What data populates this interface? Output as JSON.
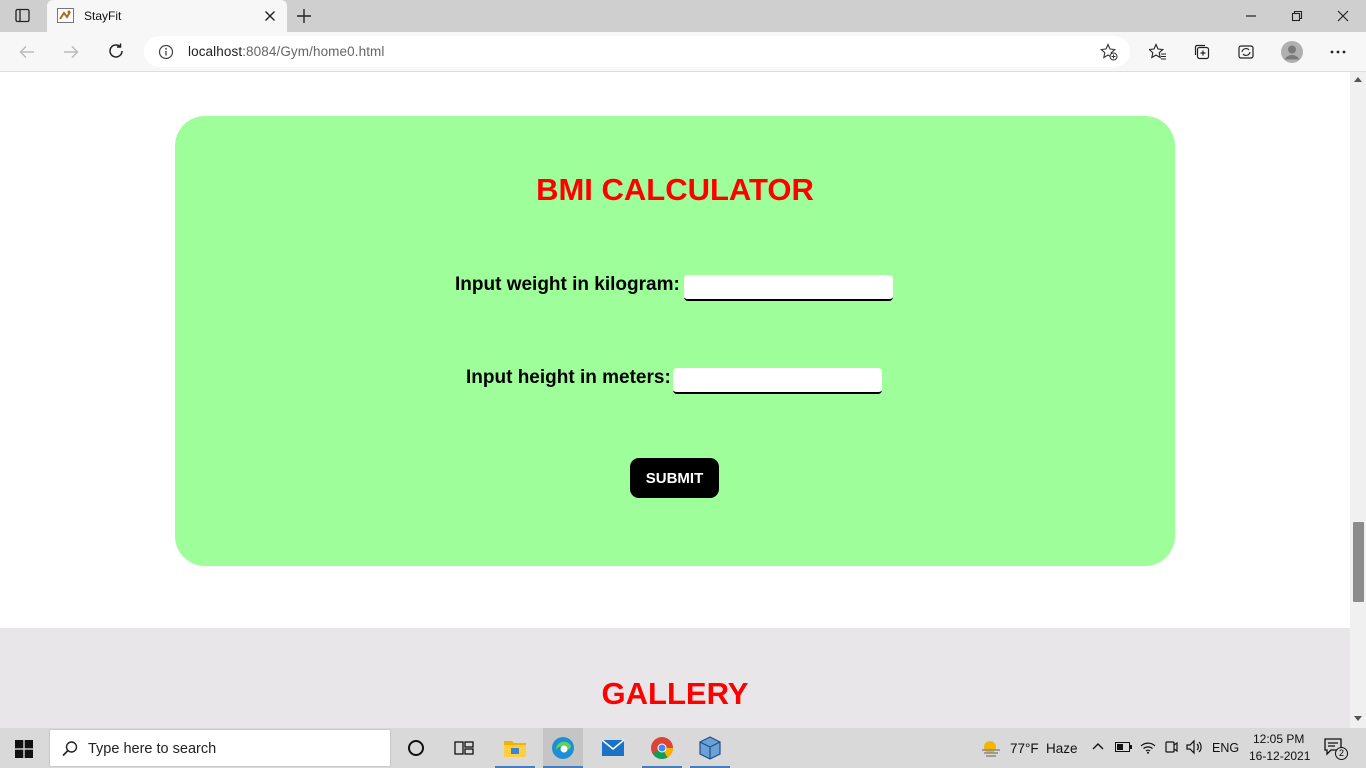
{
  "browser": {
    "tab_title": "StayFit",
    "url_host": "localhost",
    "url_rest": ":8084/Gym/home0.html"
  },
  "bmi": {
    "title": "BMI CALCULATOR",
    "weight_label": "Input weight in kilogram:",
    "weight_value": "",
    "height_label": "Input height in meters:",
    "height_value": "",
    "submit_label": "SUBMIT"
  },
  "gallery": {
    "title": "GALLERY"
  },
  "taskbar": {
    "search_placeholder": "Type here to search",
    "weather_temp": "77°F",
    "weather_desc": "Haze",
    "language": "ENG",
    "time": "12:05 PM",
    "date": "16-12-2021",
    "notification_count": "2"
  },
  "colors": {
    "card_bg": "#9eff9a",
    "title_red": "#ff0000",
    "gallery_bg": "#e8e6e8"
  }
}
